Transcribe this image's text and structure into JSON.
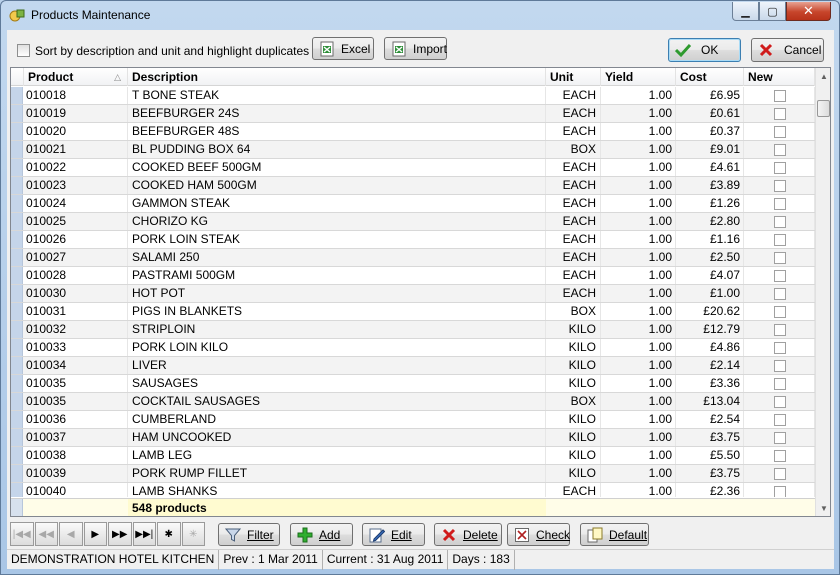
{
  "window": {
    "title": "Products Maintenance"
  },
  "toolbar": {
    "sort_label": "Sort by description and unit and highlight duplicates",
    "excel_label": "Excel",
    "import_label": "Import",
    "ok_label": "OK",
    "cancel_label": "Cancel"
  },
  "grid": {
    "columns": {
      "product": "Product",
      "description": "Description",
      "unit": "Unit",
      "yield": "Yield",
      "cost": "Cost",
      "new": "New"
    },
    "rows": [
      {
        "product": "010018",
        "description": "T BONE STEAK",
        "unit": "EACH",
        "yield": "1.00",
        "cost": "£6.95"
      },
      {
        "product": "010019",
        "description": "BEEFBURGER 24S",
        "unit": "EACH",
        "yield": "1.00",
        "cost": "£0.61"
      },
      {
        "product": "010020",
        "description": "BEEFBURGER 48S",
        "unit": "EACH",
        "yield": "1.00",
        "cost": "£0.37"
      },
      {
        "product": "010021",
        "description": "BL PUDDING BOX 64",
        "unit": "BOX",
        "yield": "1.00",
        "cost": "£9.01"
      },
      {
        "product": "010022",
        "description": "COOKED BEEF 500GM",
        "unit": "EACH",
        "yield": "1.00",
        "cost": "£4.61"
      },
      {
        "product": "010023",
        "description": "COOKED HAM 500GM",
        "unit": "EACH",
        "yield": "1.00",
        "cost": "£3.89"
      },
      {
        "product": "010024",
        "description": "GAMMON STEAK",
        "unit": "EACH",
        "yield": "1.00",
        "cost": "£1.26"
      },
      {
        "product": "010025",
        "description": "CHORIZO KG",
        "unit": "EACH",
        "yield": "1.00",
        "cost": "£2.80"
      },
      {
        "product": "010026",
        "description": "PORK LOIN STEAK",
        "unit": "EACH",
        "yield": "1.00",
        "cost": "£1.16"
      },
      {
        "product": "010027",
        "description": "SALAMI 250",
        "unit": "EACH",
        "yield": "1.00",
        "cost": "£2.50"
      },
      {
        "product": "010028",
        "description": "PASTRAMI 500GM",
        "unit": "EACH",
        "yield": "1.00",
        "cost": "£4.07"
      },
      {
        "product": "010030",
        "description": "HOT POT",
        "unit": "EACH",
        "yield": "1.00",
        "cost": "£1.00"
      },
      {
        "product": "010031",
        "description": "PIGS IN BLANKETS",
        "unit": "BOX",
        "yield": "1.00",
        "cost": "£20.62"
      },
      {
        "product": "010032",
        "description": "STRIPLOIN",
        "unit": "KILO",
        "yield": "1.00",
        "cost": "£12.79"
      },
      {
        "product": "010033",
        "description": "PORK LOIN KILO",
        "unit": "KILO",
        "yield": "1.00",
        "cost": "£4.86"
      },
      {
        "product": "010034",
        "description": "LIVER",
        "unit": "KILO",
        "yield": "1.00",
        "cost": "£2.14"
      },
      {
        "product": "010035",
        "description": "SAUSAGES",
        "unit": "KILO",
        "yield": "1.00",
        "cost": "£3.36"
      },
      {
        "product": "010035",
        "description": "COCKTAIL SAUSAGES",
        "unit": "BOX",
        "yield": "1.00",
        "cost": "£13.04"
      },
      {
        "product": "010036",
        "description": "CUMBERLAND",
        "unit": "KILO",
        "yield": "1.00",
        "cost": "£2.54"
      },
      {
        "product": "010037",
        "description": "HAM UNCOOKED",
        "unit": "KILO",
        "yield": "1.00",
        "cost": "£3.75"
      },
      {
        "product": "010038",
        "description": "LAMB LEG",
        "unit": "KILO",
        "yield": "1.00",
        "cost": "£5.50"
      },
      {
        "product": "010039",
        "description": "PORK RUMP FILLET",
        "unit": "KILO",
        "yield": "1.00",
        "cost": "£3.75"
      },
      {
        "product": "010040",
        "description": "LAMB SHANKS",
        "unit": "EACH",
        "yield": "1.00",
        "cost": "£2.36"
      }
    ],
    "footer_count": "548 products"
  },
  "actions": {
    "filter_label": "Filter",
    "add_label": "Add",
    "edit_label": "Edit",
    "delete_label": "Delete",
    "check_label": "Check",
    "default_label": "Default"
  },
  "status": {
    "company": "DEMONSTRATION HOTEL KITCHEN",
    "prev": "Prev : 1 Mar 2011",
    "current": "Current : 31 Aug 2011",
    "days": "Days : 183"
  },
  "icons": {
    "app": "products-app-icon",
    "excel": "excel-icon",
    "import": "import-icon",
    "ok": "checkmark-icon",
    "cancel": "x-icon",
    "filter": "funnel-icon",
    "add": "plus-icon",
    "edit": "pencil-icon",
    "delete": "x-icon",
    "check": "check-doc-icon",
    "default": "default-doc-icon"
  },
  "colors": {
    "ok_green": "#2e9a2e",
    "delete_red": "#d01b1b",
    "add_green": "#2fae2f",
    "footer_yellow": "#fffbd0"
  }
}
